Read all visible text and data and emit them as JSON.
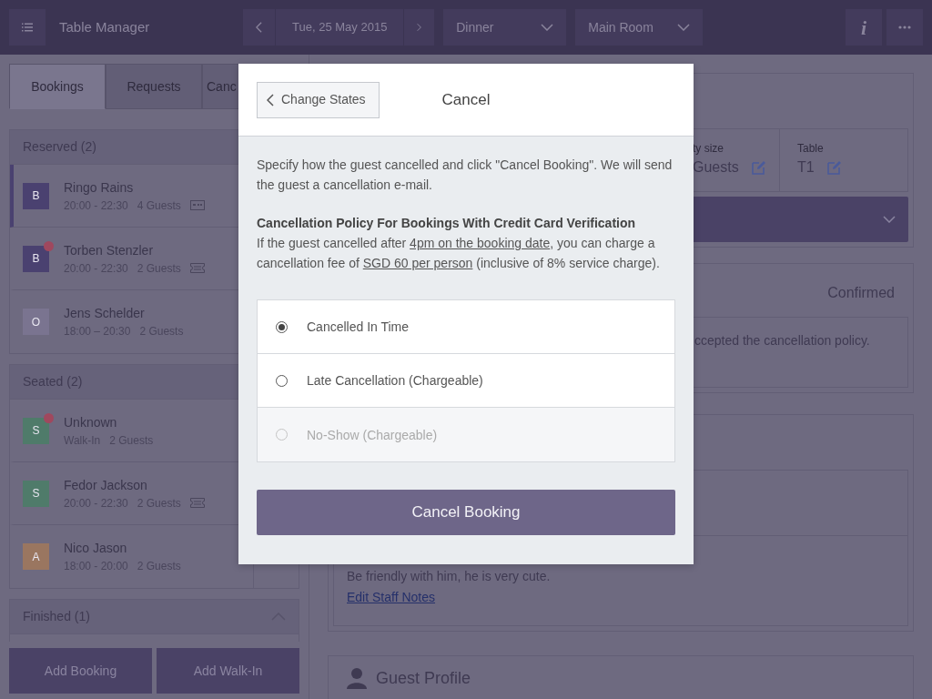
{
  "topbar": {
    "title": "Table Manager",
    "date": "Tue, 25 May 2015",
    "shift": "Dinner",
    "room": "Main Room",
    "info": "i"
  },
  "tabs": [
    {
      "label": "Bookings",
      "selected": true
    },
    {
      "label": "Requests",
      "selected": false
    },
    {
      "label": "Canc",
      "selected": false
    }
  ],
  "sections": [
    {
      "title": "Reserved (2)",
      "expanded": true,
      "items": [
        {
          "avatar": "B",
          "color": "#4a4170",
          "name": "Ringo Rains",
          "time": "20:00 - 22:30",
          "guests": "4 Guests",
          "kind": "card",
          "alert": false,
          "selected": true
        },
        {
          "avatar": "B",
          "color": "#4a4170",
          "name": "Torben Stenzler",
          "time": "20:00 - 22:30",
          "guests": "2 Guests",
          "kind": "ticket",
          "alert": true,
          "selected": false
        },
        {
          "avatar": "O",
          "color": "#7a7490",
          "name": "Jens Schelder",
          "time": "18:00 – 20:30",
          "guests": "2 Guests",
          "kind": "plain",
          "alert": false,
          "selected": false
        }
      ]
    },
    {
      "title": "Seated (2)",
      "expanded": true,
      "items": [
        {
          "avatar": "S",
          "color": "#4f7b6a",
          "name": "Unknown",
          "time": "Walk-In",
          "guests": "2 Guests",
          "kind": "plain",
          "alert": true,
          "selected": false
        },
        {
          "avatar": "S",
          "color": "#4f7b6a",
          "name": "Fedor Jackson",
          "time": "20:00 - 22:30",
          "guests": "2 Guests",
          "kind": "ticket",
          "alert": false,
          "selected": false
        },
        {
          "avatar": "A",
          "color": "#9a7660",
          "name": "Nico Jason",
          "time": "18:00 - 20:00",
          "guests": "2 Guests",
          "kind": "plain",
          "alert": false,
          "selected": false
        }
      ]
    },
    {
      "title": "Finished (1)",
      "expanded": false
    }
  ],
  "footer_buttons": [
    "Add Booking",
    "Add Walk-In"
  ],
  "details": {
    "party_label": "ty size",
    "party_value": "Guests",
    "table_label": "Table",
    "table_value": "T1",
    "status": "Confirmed",
    "policy_note": "ccepted the cancellation policy.",
    "staff_note": "Be friendly with him, he is very cute.",
    "staff_link": "Edit Staff Notes",
    "profile_title": "Guest Profile"
  },
  "modal": {
    "back": "Change States",
    "title": "Cancel",
    "intro": "Specify how the guest cancelled and click \"Cancel Booking\". We will send the guest a cancellation e-mail.",
    "policy_title": "Cancellation Policy For Bookings With Credit Card Verification",
    "policy_text": [
      {
        "kind": "text",
        "text": "If the guest cancelled after "
      },
      {
        "kind": "link",
        "text": "4pm on the booking date"
      },
      {
        "kind": "text",
        "text": ", you can charge a cancellation fee of "
      },
      {
        "kind": "link",
        "text": "SGD 60 per person"
      },
      {
        "kind": "text",
        "text": " (inclusive of 8% service charge)."
      }
    ],
    "options": [
      {
        "label": "Cancelled In Time",
        "selected": true,
        "disabled": false
      },
      {
        "label": "Late Cancellation (Chargeable)",
        "selected": false,
        "disabled": false
      },
      {
        "label": "No-Show (Chargeable)",
        "selected": false,
        "disabled": true
      }
    ],
    "submit": "Cancel Booking"
  }
}
